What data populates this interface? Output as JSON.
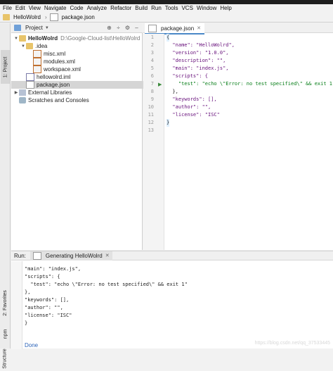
{
  "menu": [
    "File",
    "Edit",
    "View",
    "Navigate",
    "Code",
    "Analyze",
    "Refactor",
    "Build",
    "Run",
    "Tools",
    "VCS",
    "Window",
    "Help"
  ],
  "breadcrumb": {
    "project": "HelloWolrd",
    "file": "package.json"
  },
  "left_strip": {
    "project": "1: Project",
    "favorites": "2: Favorites",
    "npm": "npm",
    "structure": "Structure"
  },
  "project_panel": {
    "title": "Project",
    "tree": [
      {
        "label": "HelloWolrd",
        "path": "D:\\Google-Cloud-list\\HelloWolrd",
        "icon": "folder-icon",
        "expanded": true
      },
      {
        "label": ".idea",
        "icon": "folder-icon",
        "expanded": true
      },
      {
        "label": "misc.xml",
        "icon": "xml-file-icon"
      },
      {
        "label": "modules.xml",
        "icon": "xml-file-icon"
      },
      {
        "label": "workspace.xml",
        "icon": "xml-file-icon"
      },
      {
        "label": "hellowolrd.iml",
        "icon": "iml-file-icon"
      },
      {
        "label": "package.json",
        "icon": "json-file-icon",
        "selected": true
      },
      {
        "label": "External Libraries",
        "icon": "library-icon"
      },
      {
        "label": "Scratches and Consoles",
        "icon": "scratches-icon"
      }
    ]
  },
  "editor": {
    "tab": "package.json",
    "line_numbers": [
      "1",
      "2",
      "3",
      "4",
      "5",
      "6",
      "7",
      "8",
      "9",
      "10",
      "11",
      "12",
      "13"
    ],
    "lines": [
      "{",
      "  \"name\": \"HelloWolrd\",",
      "  \"version\": \"1.0.0\",",
      "  \"description\": \"\",",
      "  \"main\": \"index.js\",",
      "  \"scripts\": {",
      "    \"test\": \"echo \\\"Error: no test specified\\\" && exit 1\"",
      "  },",
      "  \"keywords\": [],",
      "  \"author\": \"\",",
      "  \"license\": \"ISC\"",
      "}",
      ""
    ]
  },
  "run_panel": {
    "label": "Run:",
    "tab": "Generating HelloWolrd",
    "output": [
      "\"main\": \"index.js\",",
      "\"scripts\": {",
      "  \"test\": \"echo \\\"Error: no test specified\\\" && exit 1\"",
      "},",
      "\"keywords\": [],",
      "\"author\": \"\",",
      "\"license\": \"ISC\"",
      "}"
    ],
    "status": "Done",
    "watermark": "https://blog.csdn.net/qq_37533445"
  }
}
